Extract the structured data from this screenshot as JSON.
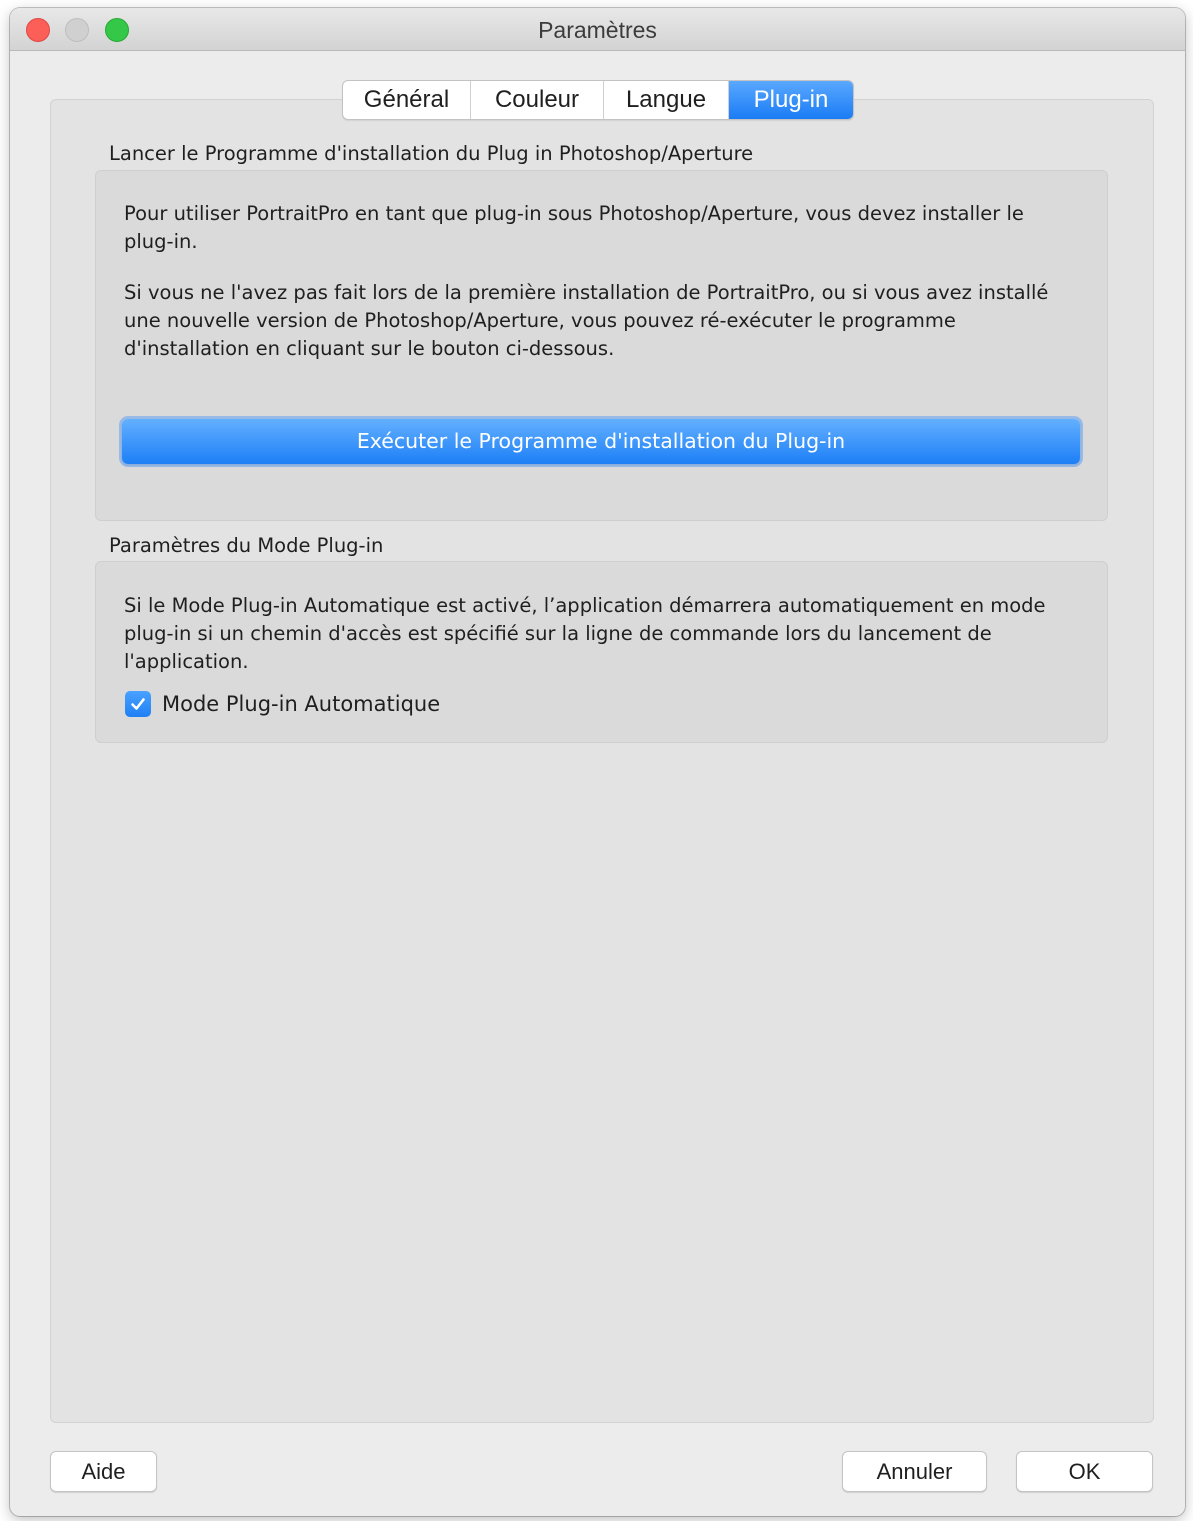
{
  "window": {
    "title": "Paramètres"
  },
  "tabs": [
    {
      "label": "Général",
      "active": false
    },
    {
      "label": "Couleur",
      "active": false
    },
    {
      "label": "Langue",
      "active": false
    },
    {
      "label": "Plug-in",
      "active": true
    }
  ],
  "installer_section": {
    "label": "Lancer le Programme d'installation du Plug in Photoshop/Aperture",
    "paragraph1": "Pour utiliser PortraitPro en tant que plug-in sous Photoshop/Aperture, vous devez installer le plug-in.",
    "paragraph2": "Si vous ne l'avez pas fait lors de la première installation de PortraitPro, ou si vous avez installé une nouvelle version de Photoshop/Aperture, vous pouvez ré-exécuter le programme d'installation en cliquant sur le bouton ci-dessous.",
    "button_label": "Exécuter le Programme d'installation du Plug-in"
  },
  "mode_section": {
    "label": "Paramètres du Mode Plug-in",
    "paragraph": "Si le Mode Plug-in Automatique est activé, l’application démarrera automatiquement en mode plug-in si un chemin d'accès est spécifié sur la ligne de commande lors du lancement de l'application.",
    "checkbox_label": "Mode Plug-in Automatique",
    "checkbox_checked": true
  },
  "footer": {
    "help_label": "Aide",
    "cancel_label": "Annuler",
    "ok_label": "OK"
  },
  "colors": {
    "accent": "#1a7cf5",
    "close": "#fc5f57",
    "zoom": "#34c748"
  }
}
